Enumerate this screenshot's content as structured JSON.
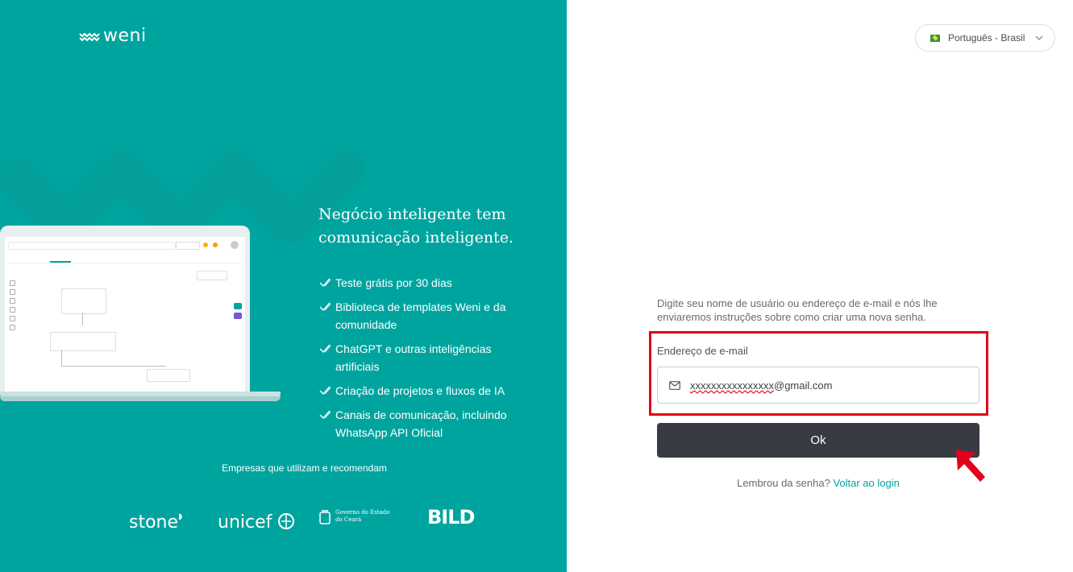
{
  "brand": {
    "name": "weni",
    "color": "#00A49F"
  },
  "left": {
    "headline": "Negócio inteligente tem comunicação inteligente.",
    "features": [
      "Teste grátis por 30 dias",
      "Biblioteca de templates Weni e da comunidade",
      "ChatGPT e outras inteligências artificiais",
      "Criação de projetos e fluxos de IA",
      "Canais de comunicação, incluindo WhatsApp API Oficial"
    ],
    "partners_title": "Empresas que utilizam e recomendam",
    "partners": [
      "stone",
      "unicef",
      "Governo do Estado do Ceará",
      "BILD"
    ]
  },
  "language": {
    "selected": "Português - Brasil",
    "icon": "chevron-down-icon"
  },
  "form": {
    "description": "Digite seu nome de usuário ou endereço de e-mail e nós lhe enviaremos instruções sobre como criar uma nova senha.",
    "email_label": "Endereço de e-mail",
    "email_value_masked": "xxxxxxxxxxxxxxxx",
    "email_value_domain": "@gmail.com",
    "submit_label": "Ok",
    "remember_text": "Lembrou da senha?",
    "back_link": "Voltar ao login",
    "highlight_color": "#e2001a",
    "button_color": "#393b43"
  }
}
